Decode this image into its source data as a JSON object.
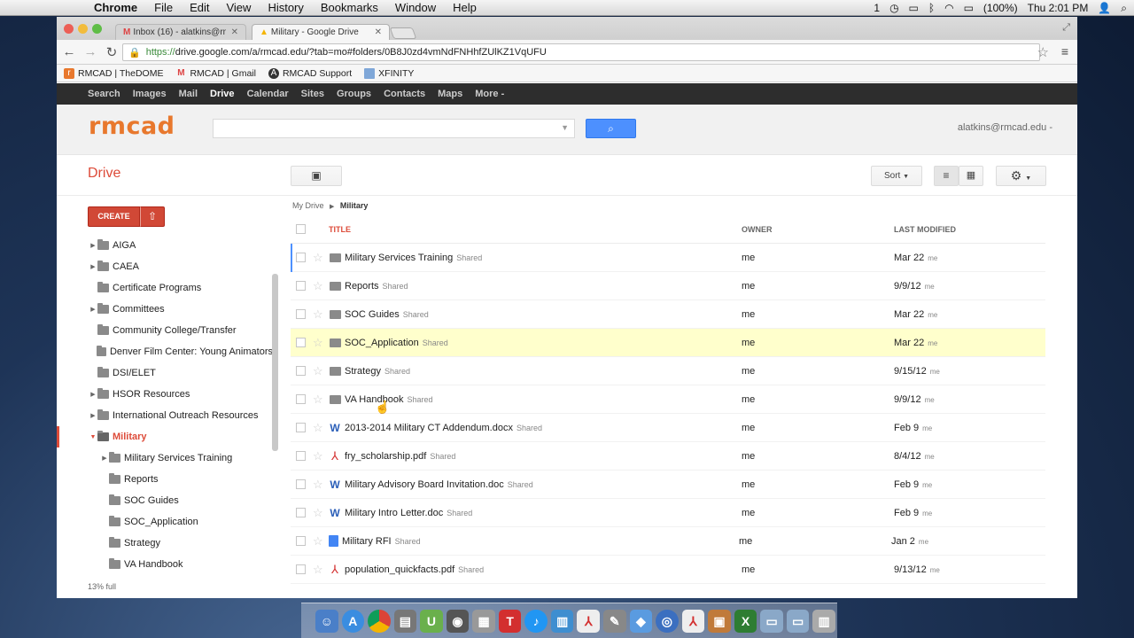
{
  "os_menubar": {
    "app": "Chrome",
    "items": [
      "File",
      "Edit",
      "View",
      "History",
      "Bookmarks",
      "Window",
      "Help"
    ],
    "status": {
      "battery": "(100%)",
      "clock": "Thu 2:01 PM",
      "badge": "1"
    }
  },
  "browser": {
    "tabs": [
      {
        "title": "Inbox (16) - alatkins@rmc"
      },
      {
        "title": "Military - Google Drive"
      }
    ],
    "url_prefix": "https://",
    "url_rest": "drive.google.com/a/rmcad.edu/?tab=mo#folders/0B8J0zd4vmNdFNHhfZUlKZ1VqUFU",
    "bookmarks": [
      "RMCAD | TheDOME",
      "RMCAD | Gmail",
      "RMCAD Support",
      "XFINITY"
    ]
  },
  "google_bar": [
    "Search",
    "Images",
    "Mail",
    "Drive",
    "Calendar",
    "Sites",
    "Groups",
    "Contacts",
    "Maps",
    "More -"
  ],
  "header": {
    "logo": "rmcad",
    "user": "alatkins@rmcad.edu -"
  },
  "drive": {
    "title": "Drive",
    "create": "CREATE",
    "sort": "Sort",
    "quota": "13% full"
  },
  "sidebar": {
    "items": [
      {
        "label": "AIGA",
        "arrow": "▶",
        "indent": 0
      },
      {
        "label": "CAEA",
        "arrow": "▶",
        "indent": 0
      },
      {
        "label": "Certificate Programs",
        "arrow": "",
        "indent": 0
      },
      {
        "label": "Committees",
        "arrow": "▶",
        "indent": 0
      },
      {
        "label": "Community College/Transfer",
        "arrow": "",
        "indent": 0
      },
      {
        "label": "Denver Film Center: Young Animators",
        "arrow": "",
        "indent": 0
      },
      {
        "label": "DSI/ELET",
        "arrow": "",
        "indent": 0
      },
      {
        "label": "HSOR Resources",
        "arrow": "▶",
        "indent": 0
      },
      {
        "label": "International Outreach Resources",
        "arrow": "▶",
        "indent": 0
      },
      {
        "label": "Military",
        "arrow": "▼",
        "indent": 0,
        "selected": true
      },
      {
        "label": "Military Services Training",
        "arrow": "▶",
        "indent": 1
      },
      {
        "label": "Reports",
        "arrow": "",
        "indent": 1
      },
      {
        "label": "SOC Guides",
        "arrow": "",
        "indent": 1
      },
      {
        "label": "SOC_Application",
        "arrow": "",
        "indent": 1
      },
      {
        "label": "Strategy",
        "arrow": "",
        "indent": 1
      },
      {
        "label": "VA Handbook",
        "arrow": "",
        "indent": 1
      }
    ]
  },
  "breadcrumb": {
    "root": "My Drive",
    "current": "Military"
  },
  "list": {
    "headers": {
      "title": "TITLE",
      "owner": "OWNER",
      "modified": "LAST MODIFIED"
    },
    "rows": [
      {
        "name": "Military Services Training",
        "type": "folder",
        "shared": "Shared",
        "owner": "me",
        "modified": "Mar 22",
        "mod_by": "me"
      },
      {
        "name": "Reports",
        "type": "folder",
        "shared": "Shared",
        "owner": "me",
        "modified": "9/9/12",
        "mod_by": "me"
      },
      {
        "name": "SOC Guides",
        "type": "folder",
        "shared": "Shared",
        "owner": "me",
        "modified": "Mar 22",
        "mod_by": "me"
      },
      {
        "name": "SOC_Application",
        "type": "folder",
        "shared": "Shared",
        "owner": "me",
        "modified": "Mar 22",
        "mod_by": "me"
      },
      {
        "name": "Strategy",
        "type": "folder",
        "shared": "Shared",
        "owner": "me",
        "modified": "9/15/12",
        "mod_by": "me"
      },
      {
        "name": "VA Handbook",
        "type": "folder",
        "shared": "Shared",
        "owner": "me",
        "modified": "9/9/12",
        "mod_by": "me"
      },
      {
        "name": "2013-2014 Military CT Addendum.docx",
        "type": "word",
        "shared": "Shared",
        "owner": "me",
        "modified": "Feb 9",
        "mod_by": "me"
      },
      {
        "name": "fry_scholarship.pdf",
        "type": "pdf",
        "shared": "Shared",
        "owner": "me",
        "modified": "8/4/12",
        "mod_by": "me"
      },
      {
        "name": "Military Advisory Board Invitation.doc",
        "type": "word",
        "shared": "Shared",
        "owner": "me",
        "modified": "Feb 9",
        "mod_by": "me"
      },
      {
        "name": "Military Intro Letter.doc",
        "type": "word",
        "shared": "Shared",
        "owner": "me",
        "modified": "Feb 9",
        "mod_by": "me"
      },
      {
        "name": "Military RFI",
        "type": "gdoc",
        "shared": "Shared",
        "owner": "me",
        "modified": "Jan 2",
        "mod_by": "me"
      },
      {
        "name": "population_quickfacts.pdf",
        "type": "pdf",
        "shared": "Shared",
        "owner": "me",
        "modified": "9/13/12",
        "mod_by": "me"
      }
    ]
  }
}
